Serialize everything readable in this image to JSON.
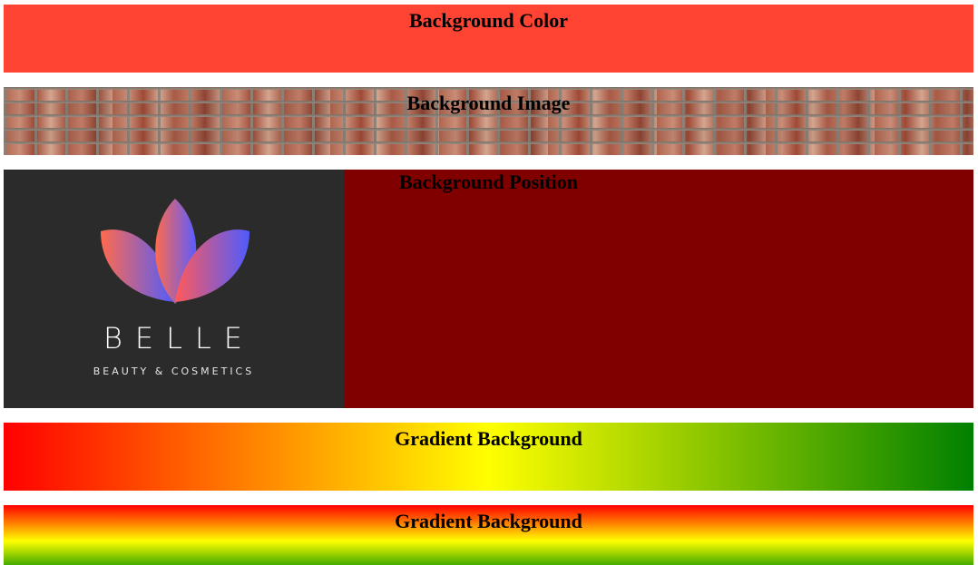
{
  "sections": {
    "color": {
      "title": "Background Color",
      "bg": "#ff4433"
    },
    "image": {
      "title": "Background Image",
      "pattern": "brick-wall"
    },
    "position": {
      "title": "Background Position",
      "bg": "#800000",
      "logo": {
        "name": "BELLE",
        "tagline": "BEAUTY & COSMETICS",
        "icon": "lotus-icon",
        "colors": {
          "gradient_start": "#ff6a4d",
          "gradient_end": "#4f5bff",
          "panel": "#2b2b2b"
        }
      }
    },
    "gradient_horizontal": {
      "title": "Gradient Background",
      "colors": [
        "#ff0000",
        "#ffff00",
        "#008000"
      ]
    },
    "gradient_vertical": {
      "title": "Gradient Background",
      "colors": [
        "#ff0000",
        "#ffff00",
        "#44aa00"
      ]
    }
  }
}
